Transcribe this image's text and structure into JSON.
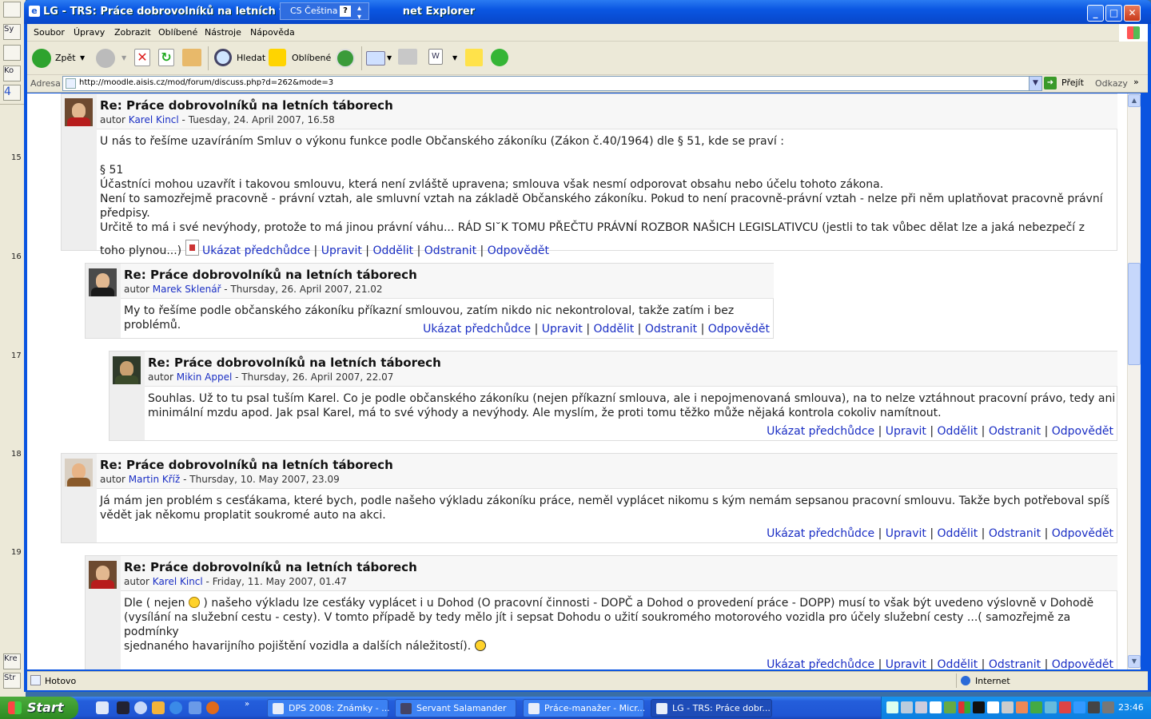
{
  "window": {
    "title": "LG - TRS: Práce dobrovolníků na letních tábore",
    "title_suffix": "net Explorer"
  },
  "language_bar": {
    "code": "CS",
    "name": "Čeština",
    "help": "?"
  },
  "background_app": {
    "line_numbers": [
      "15",
      "16",
      "17",
      "18",
      "19"
    ],
    "labels": [
      "Ko",
      "4",
      "Kre",
      "Str",
      "Sy"
    ]
  },
  "menu": [
    "Soubor",
    "Úpravy",
    "Zobrazit",
    "Oblíbené",
    "Nástroje",
    "Nápověda"
  ],
  "toolbar": {
    "back": "Zpět",
    "search": "Hledat",
    "favorites": "Oblíbené"
  },
  "address": {
    "label": "Adresa",
    "url": "http://moodle.aisis.cz/mod/forum/discuss.php?d=262&mode=3",
    "go": "Přejít",
    "links": "Odkazy"
  },
  "status": {
    "text": "Hotovo",
    "zone": "Internet"
  },
  "commands": {
    "show_parent": "Ukázat předchůdce",
    "edit": "Upravit",
    "split": "Oddělit",
    "delete": "Odstranit",
    "reply": "Odpovědět",
    "sep": "|"
  },
  "posts": [
    {
      "subject": "Re: Práce dobrovolníků na letních táborech",
      "author_prefix": "autor",
      "author": "Karel Kincl",
      "date": " - Tuesday, 24. April 2007, 16.58",
      "p1": "U nás to řešíme uzavíráním Smluv o výkonu funkce podle Občanského zákoníku (Zákon č.40/1964) dle § 51, kde se praví :",
      "p2": "§ 51",
      "p3": "Účastníci mohou uzavřít i takovou smlouvu, která není zvláště upravena; smlouva však nesmí odporovat obsahu nebo účelu tohoto zákona.",
      "p4": "Není to samozřejmě pracovně - právní vztah, ale smluvní vztah na základě Občanského zákoníku. Pokud to není pracovně-právní vztah - nelze při něm uplatňovat pracovně právní předpisy.",
      "p5": "Určitě to má i své nevýhody, protože to má jinou právní váhu... RÁD SI˘K TOMU PŘEČTU PRÁVNÍ ROZBOR NAŠICH LEGISLATIVCU (jestli to tak vůbec dělat lze a jaká nebezpečí z",
      "p6": "toho plynou...)"
    },
    {
      "subject": "Re: Práce dobrovolníků na letních táborech",
      "author_prefix": "autor",
      "author": "Marek Sklenář",
      "date": " - Thursday, 26. April 2007, 21.02",
      "p1": "My to řešíme podle občanského zákoníku příkazní smlouvou, zatím nikdo nic nekontroloval, takže zatím i bez problémů."
    },
    {
      "subject": "Re: Práce dobrovolníků na letních táborech",
      "author_prefix": "autor",
      "author": "Mikin Appel",
      "date": " - Thursday, 26. April 2007, 22.07",
      "p1": "Souhlas. Už to tu psal tuším Karel. Co je podle občanského zákoníku (nejen příkazní smlouva, ale i nepojmenovaná smlouva), na to nelze vztáhnout pracovní právo, tedy ani",
      "p2": "minimální mzdu apod. Jak psal Karel, má to své výhody a nevýhody. Ale myslím, že proti tomu těžko může nějaká kontrola cokoliv namítnout."
    },
    {
      "subject": "Re: Práce dobrovolníků na letních táborech",
      "author_prefix": "autor",
      "author": "Martin Kříž",
      "date": " - Thursday, 10. May 2007, 23.09",
      "p1": "Já mám jen problém s cesťákama, které bych, podle našeho výkladu zákoníku práce, neměl vyplácet nikomu s kým nemám sepsanou pracovní smlouvu. Takže bych potřeboval spíš",
      "p2": "vědět jak někomu proplatit soukromé auto na akci."
    },
    {
      "subject": "Re: Práce dobrovolníků na letních táborech",
      "author_prefix": "autor",
      "author": "Karel Kincl",
      "date": " - Friday, 11. May 2007, 01.47",
      "p1a": "Dle ( nejen ",
      "p1b": " ) našeho výkladu lze cesťáky vyplácet i u Dohod (O pracovní činnosti - DOPČ a Dohod o provedení práce - DOPP) musí to však být uvedeno výslovně v Dohodě",
      "p2": "(vysílání na služební cestu - cesty). V tomto případě by tedy mělo jít i sepsat Dohodu o užití soukromého motorového vozidla pro účely služební cesty ...( samozřejmě za podmínky",
      "p3": "sjednaného havarijního pojištění vozidla a dalších náležitostí).  "
    }
  ],
  "taskbar": {
    "start": "Start",
    "tasks": [
      "DPS 2008: Známky - ...",
      "Servant Salamander",
      "Práce-manažer - Micr...",
      "LG - TRS: Práce dobr..."
    ],
    "clock": "23:46"
  }
}
